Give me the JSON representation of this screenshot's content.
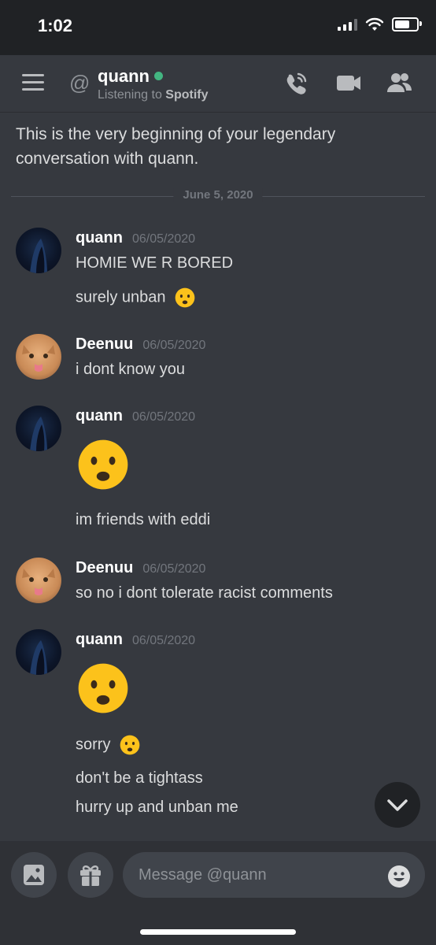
{
  "status": {
    "time": "1:02"
  },
  "header": {
    "name": "quann",
    "activity_prefix": "Listening to",
    "activity_app": "Spotify"
  },
  "intro": "This is the very beginning of your legendary conversation with quann.",
  "date_divider": "June 5, 2020",
  "messages": [
    {
      "author": "quann",
      "timestamp": "06/05/2020",
      "lines": [
        "HOMIE WE R BORED",
        "surely unban"
      ]
    },
    {
      "author": "Deenuu",
      "timestamp": "06/05/2020",
      "lines": [
        "i dont know you"
      ]
    },
    {
      "author": "quann",
      "timestamp": "06/05/2020",
      "lines": [
        "im friends with eddi"
      ]
    },
    {
      "author": "Deenuu",
      "timestamp": "06/05/2020",
      "lines": [
        "so no i dont tolerate racist comments"
      ]
    },
    {
      "author": "quann",
      "timestamp": "06/05/2020",
      "lines": [
        "sorry",
        "don't be a tightass",
        "hurry up and unban me"
      ]
    }
  ],
  "composer": {
    "placeholder": "Message @quann"
  },
  "icons": {
    "menu": "hamburger-icon",
    "mention": "at-icon",
    "call": "phone-call-icon",
    "video": "video-camera-icon",
    "members": "members-icon",
    "image": "image-icon",
    "gift": "gift-icon",
    "emoji": "smiley-icon",
    "scroll": "chevron-down-icon"
  },
  "colors": {
    "background": "#36393f",
    "online": "#43b581",
    "bar": "#202225"
  }
}
